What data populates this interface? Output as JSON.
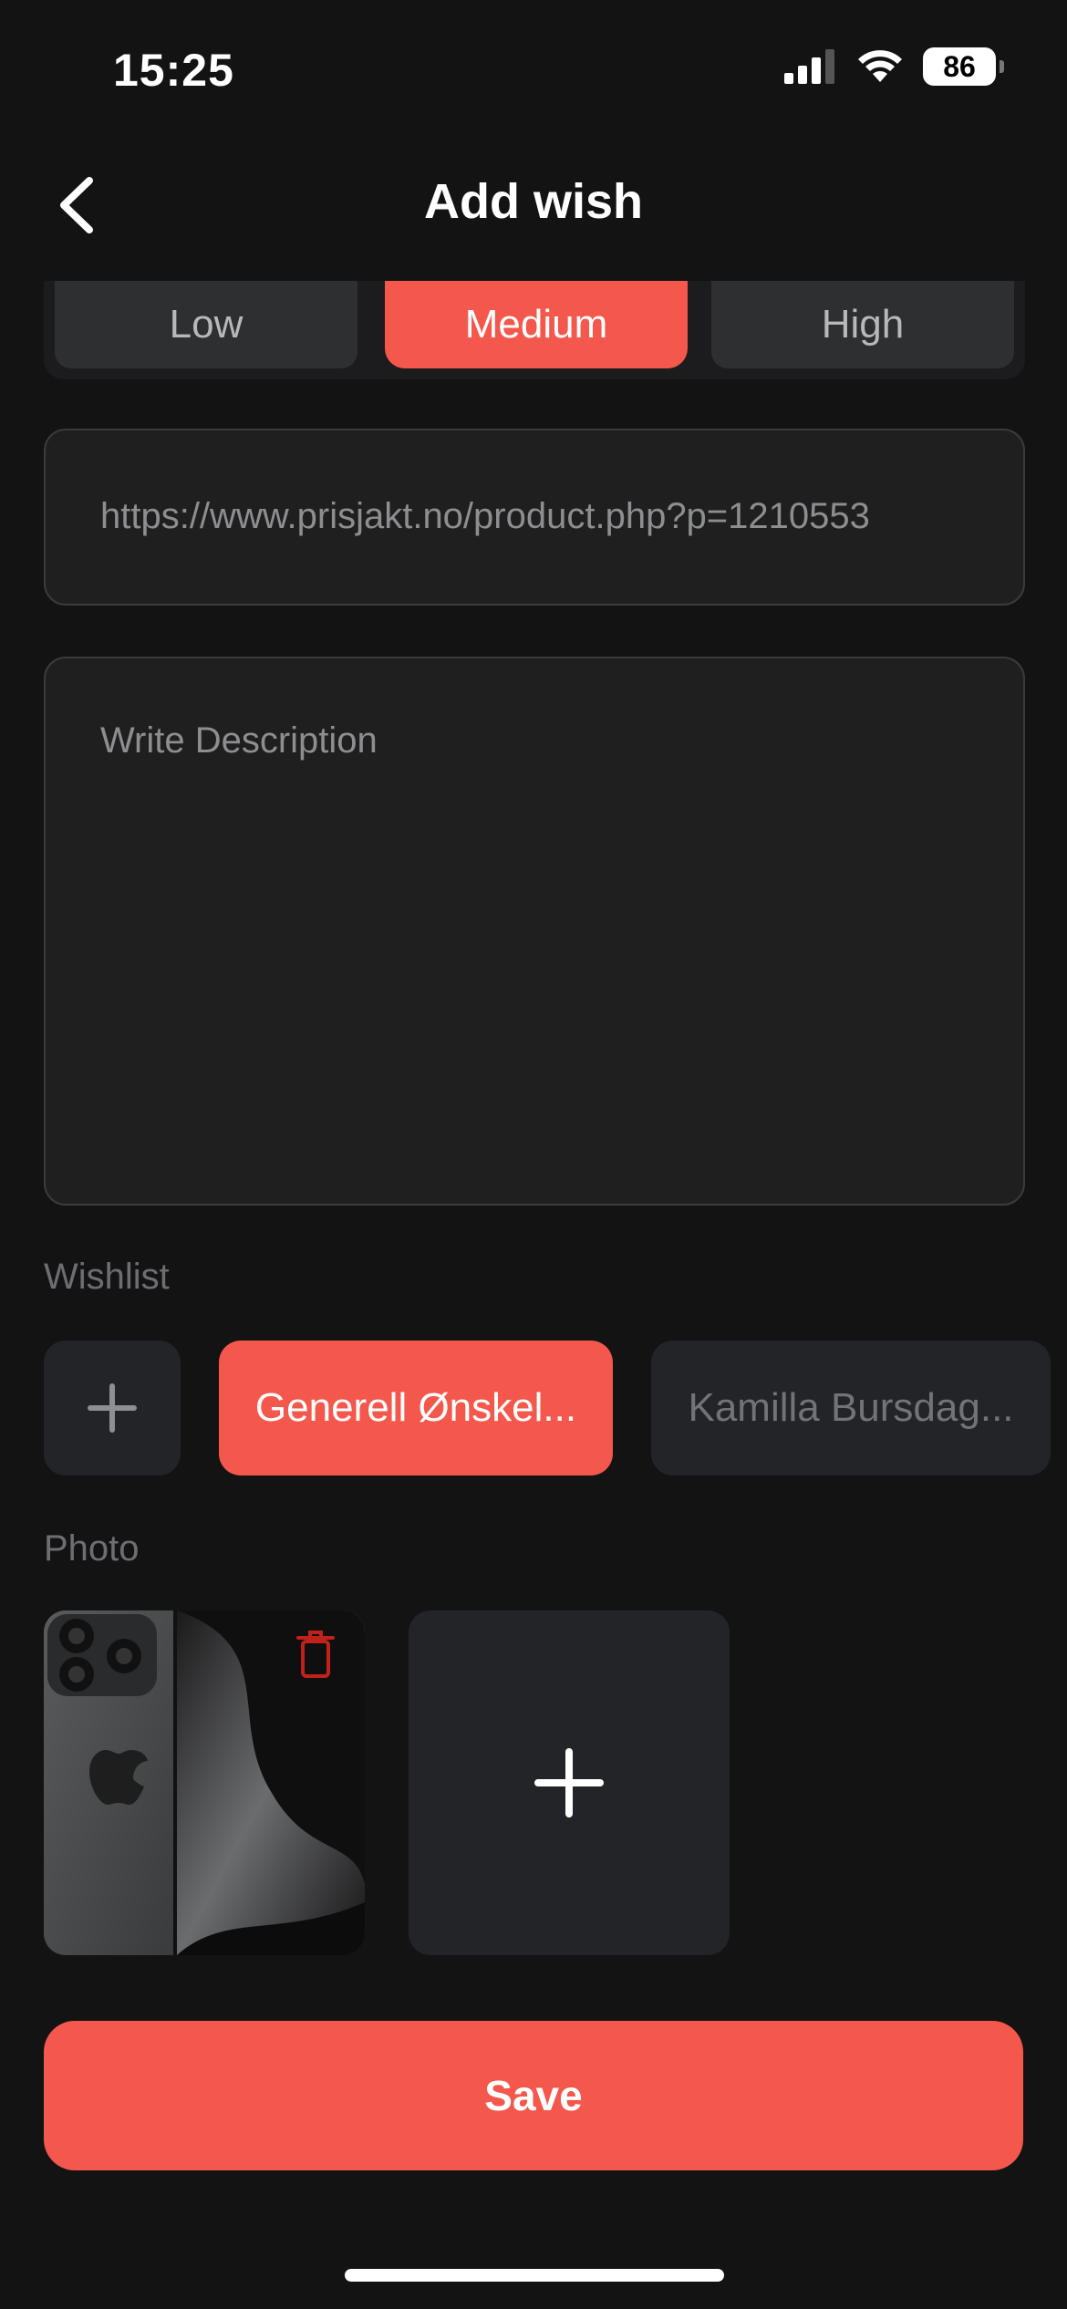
{
  "status": {
    "time": "15:25",
    "battery": "86"
  },
  "nav": {
    "title": "Add wish"
  },
  "priority": {
    "options": [
      "Low",
      "Medium",
      "High"
    ],
    "selected": "Medium"
  },
  "link_field": {
    "placeholder": "https://www.prisjakt.no/product.php?p=1210553"
  },
  "description_field": {
    "placeholder": "Write Description"
  },
  "wishlist": {
    "label": "Wishlist",
    "chips": [
      "Generell Ønskel...",
      "Kamilla Bursdag..."
    ],
    "selected": "Generell Ønskel..."
  },
  "photo": {
    "label": "Photo"
  },
  "save": {
    "label": "Save"
  },
  "colors": {
    "accent": "#f4574b",
    "background": "#131314",
    "surface": "#1f1f20"
  }
}
